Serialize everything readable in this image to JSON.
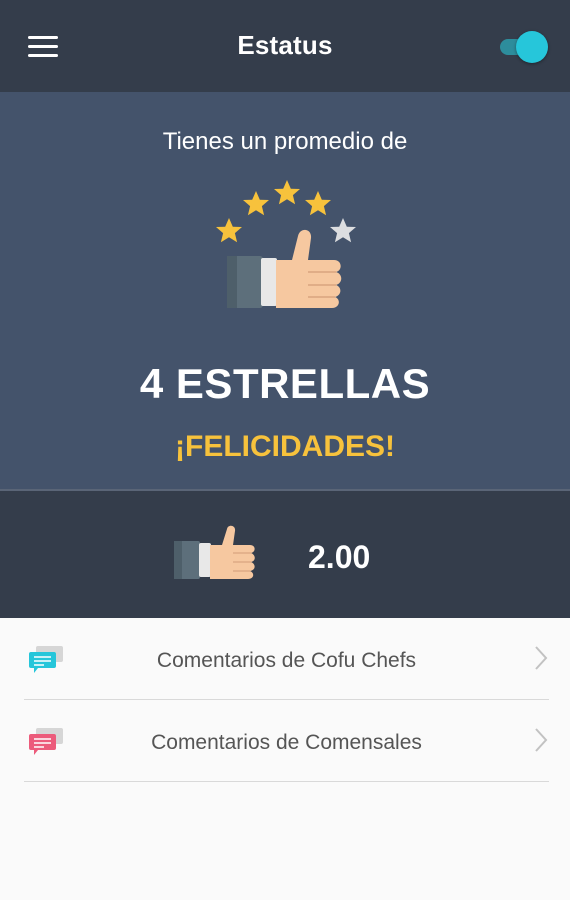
{
  "header": {
    "title": "Estatus",
    "menu_icon": "hamburger-menu-icon",
    "toggle_on": true,
    "toggle_color": "#26c6da"
  },
  "hero": {
    "subtitle": "Tienes un promedio de",
    "rating_text": "4 ESTRELLAS",
    "congrats_text": "¡FELICIDADES!",
    "stars_filled": 4,
    "stars_total": 5,
    "icon": "thumbs-up-stars-icon",
    "congrats_color": "#f7c23c"
  },
  "score": {
    "icon": "thumbs-up-icon",
    "value": "2.00"
  },
  "list": {
    "items": [
      {
        "label": "Comentarios de Cofu Chefs",
        "icon": "chat-bubbles-icon",
        "icon_color": "#26c6da"
      },
      {
        "label": "Comentarios de Comensales",
        "icon": "chat-bubbles-icon",
        "icon_color": "#ec5b7b"
      }
    ]
  },
  "colors": {
    "header_bg": "#343d4b",
    "hero_bg": "#44536b",
    "list_bg": "#fafafa"
  }
}
